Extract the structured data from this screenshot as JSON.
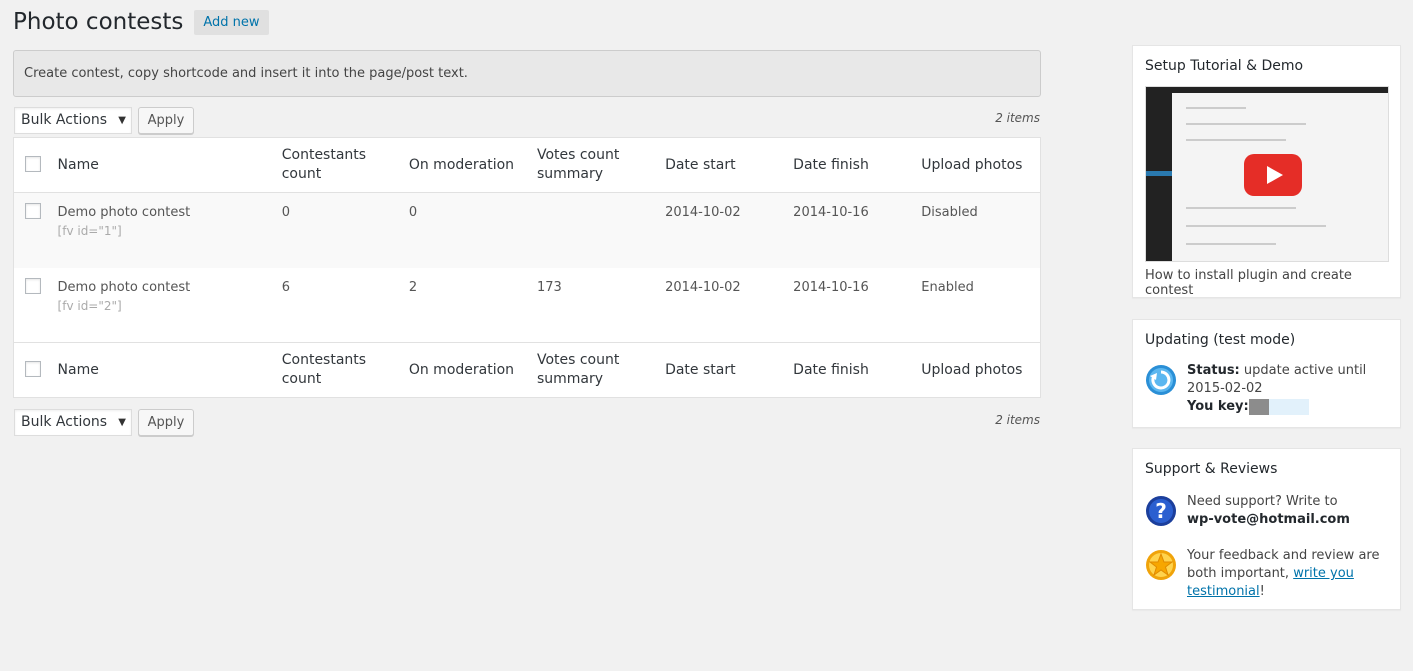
{
  "page": {
    "title": "Photo contests",
    "add_new_label": "Add new",
    "notice": "Create contest, copy shortcode and insert it into the page/post text."
  },
  "tablenav": {
    "bulk_actions": "Bulk Actions",
    "apply_label": "Apply",
    "items_count": "2 items"
  },
  "table": {
    "columns": [
      "Name",
      "Contestants count",
      "On moderation",
      "Votes count summary",
      "Date start",
      "Date finish",
      "Upload photos"
    ],
    "rows": [
      {
        "name": "Demo photo contest",
        "shortcode": "[fv id=\"1\"]",
        "contestants": "0",
        "moderation": "0",
        "votes": "",
        "date_start": "2014-10-02",
        "date_finish": "2014-10-16",
        "upload": "Disabled"
      },
      {
        "name": "Demo photo contest",
        "shortcode": "[fv id=\"2\"]",
        "contestants": "6",
        "moderation": "2",
        "votes": "173",
        "date_start": "2014-10-02",
        "date_finish": "2014-10-16",
        "upload": "Enabled"
      }
    ]
  },
  "sidebar": {
    "tutorial": {
      "title": "Setup Tutorial & Demo",
      "caption": "How to install plugin and create contest",
      "icon": "video-play-icon"
    },
    "updating": {
      "title": "Updating (test mode)",
      "status_label": "Status:",
      "status_value": "update active until 2015-02-02",
      "key_label": "You key:",
      "icon": "refresh-icon"
    },
    "support": {
      "title": "Support & Reviews",
      "support_text": "Need support? Write to",
      "support_email": "wp-vote@hotmail.com",
      "review_text": "Your feedback and review are both important,",
      "review_link": "write you testimonial",
      "review_suffix": "!",
      "icons": [
        "help-icon",
        "star-icon"
      ]
    }
  },
  "colors": {
    "accent": "#0073aa",
    "youtube_red": "#e52d27"
  }
}
